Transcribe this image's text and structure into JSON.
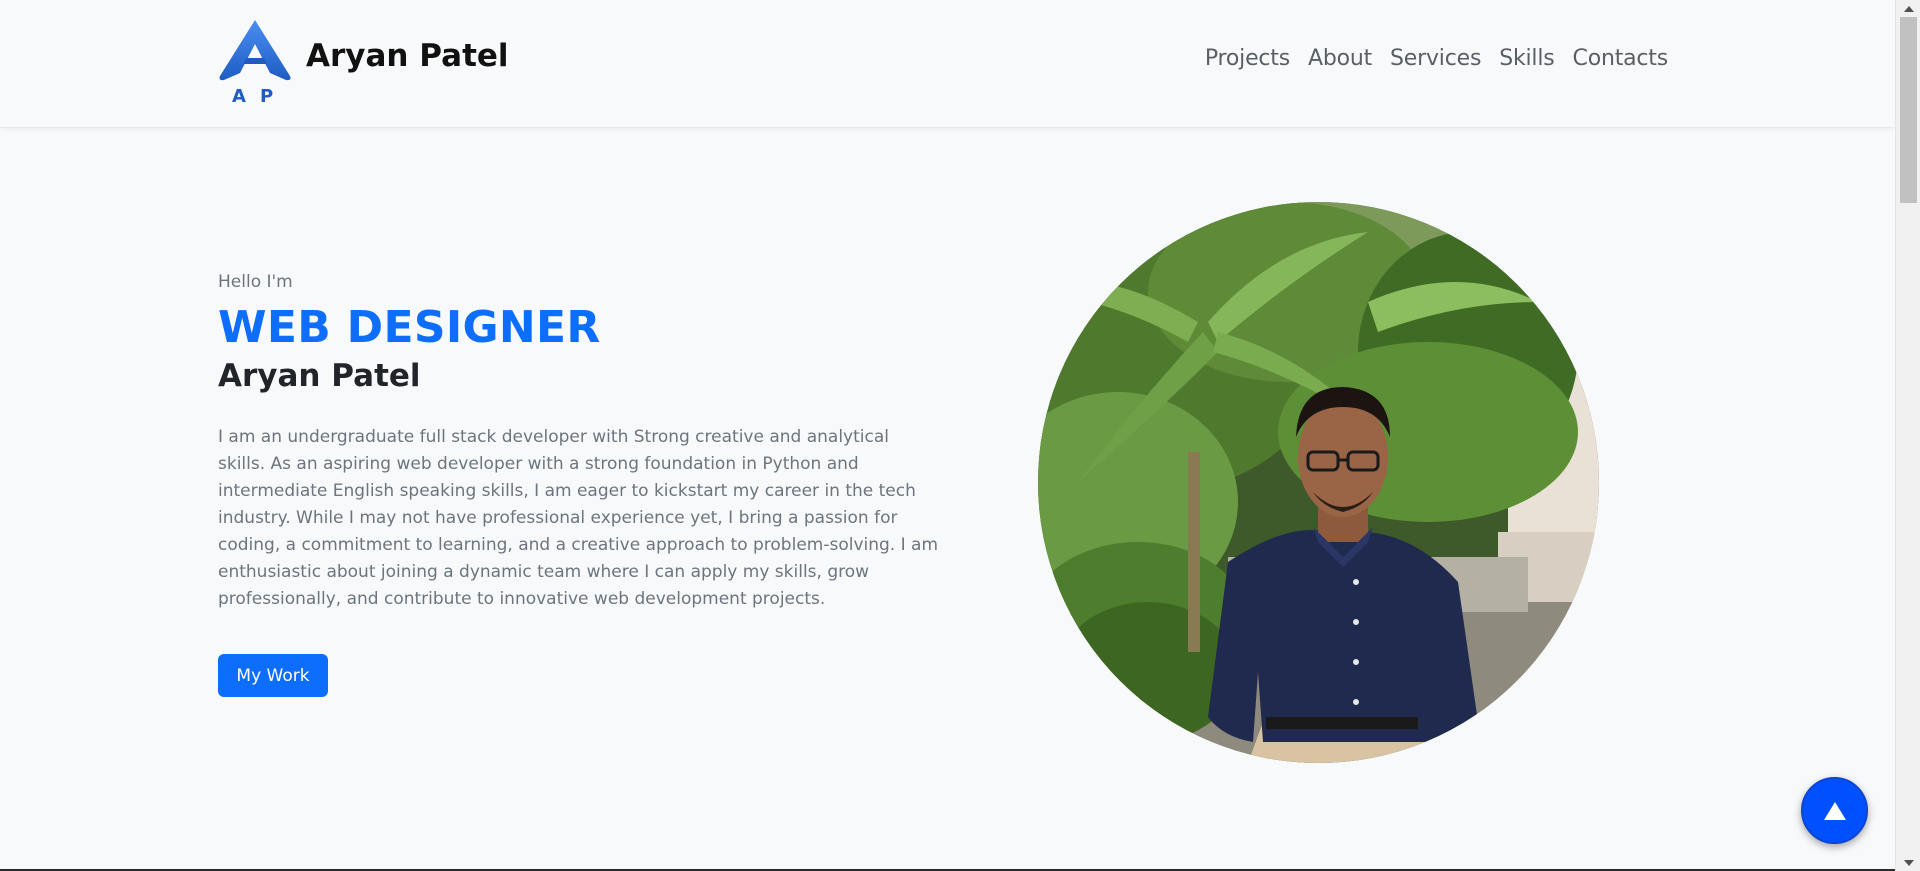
{
  "header": {
    "logo_text": "A P",
    "brand_name": "Aryan Patel",
    "nav": [
      "Projects",
      "About",
      "Services",
      "Skills",
      "Contacts"
    ]
  },
  "hero": {
    "greeting": "Hello I'm",
    "role": "WEB DESIGNER",
    "name": "Aryan Patel",
    "bio": "I am an undergraduate full stack developer with Strong creative and analytical skills. As an aspiring web developer with a strong foundation in Python and intermediate English speaking skills, I am eager to kickstart my career in the tech industry. While I may not have professional experience yet, I bring a passion for coding, a commitment to learning, and a creative approach to problem-solving. I am enthusiastic about joining a dynamic team where I can apply my skills, grow professionally, and contribute to innovative web development projects.",
    "cta_label": "My Work",
    "portrait_icon": "portrait-photo"
  },
  "controls": {
    "back_to_top_icon": "arrow-up-icon"
  },
  "colors": {
    "accent": "#0d6efd",
    "back_to_top": "#0050ff",
    "background": "#f8f9fa",
    "muted_text": "#6c757d"
  }
}
